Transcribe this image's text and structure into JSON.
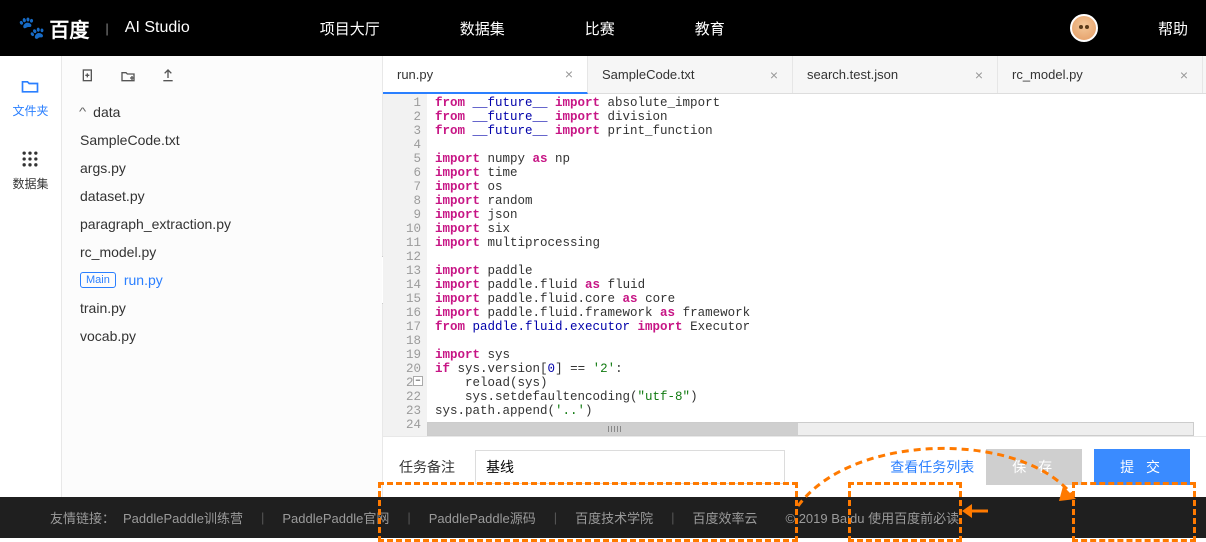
{
  "topnav": {
    "logo_text": "百度",
    "product": "AI Studio",
    "items": [
      "项目大厅",
      "数据集",
      "比赛",
      "教育"
    ],
    "help": "帮助"
  },
  "left_rail": {
    "files": "文件夹",
    "datasets": "数据集"
  },
  "file_tree": {
    "folder": "data",
    "items": [
      "SampleCode.txt",
      "args.py",
      "dataset.py",
      "paragraph_extraction.py",
      "rc_model.py",
      "run.py",
      "train.py",
      "vocab.py"
    ],
    "main_badge": "Main",
    "main_file": "run.py"
  },
  "tabs": [
    {
      "label": "run.py",
      "active": true
    },
    {
      "label": "SampleCode.txt",
      "active": false
    },
    {
      "label": "search.test.json",
      "active": false
    },
    {
      "label": "rc_model.py",
      "active": false
    }
  ],
  "code": {
    "lines": [
      [
        [
          "from",
          "kw-from"
        ],
        [
          " __future__ ",
          "kw-mod"
        ],
        [
          "import",
          "kw-import"
        ],
        [
          " absolute_import",
          ""
        ]
      ],
      [
        [
          "from",
          "kw-from"
        ],
        [
          " __future__ ",
          "kw-mod"
        ],
        [
          "import",
          "kw-import"
        ],
        [
          " division",
          ""
        ]
      ],
      [
        [
          "from",
          "kw-from"
        ],
        [
          " __future__ ",
          "kw-mod"
        ],
        [
          "import",
          "kw-import"
        ],
        [
          " print_function",
          ""
        ]
      ],
      [],
      [
        [
          "import",
          "kw-import"
        ],
        [
          " numpy ",
          ""
        ],
        [
          "as",
          "kw-as"
        ],
        [
          " np",
          ""
        ]
      ],
      [
        [
          "import",
          "kw-import"
        ],
        [
          " time",
          ""
        ]
      ],
      [
        [
          "import",
          "kw-import"
        ],
        [
          " os",
          ""
        ]
      ],
      [
        [
          "import",
          "kw-import"
        ],
        [
          " random",
          ""
        ]
      ],
      [
        [
          "import",
          "kw-import"
        ],
        [
          " json",
          ""
        ]
      ],
      [
        [
          "import",
          "kw-import"
        ],
        [
          " six",
          ""
        ]
      ],
      [
        [
          "import",
          "kw-import"
        ],
        [
          " multiprocessing",
          ""
        ]
      ],
      [],
      [
        [
          "import",
          "kw-import"
        ],
        [
          " paddle",
          ""
        ]
      ],
      [
        [
          "import",
          "kw-import"
        ],
        [
          " paddle.fluid ",
          ""
        ],
        [
          "as",
          "kw-as"
        ],
        [
          " fluid",
          ""
        ]
      ],
      [
        [
          "import",
          "kw-import"
        ],
        [
          " paddle.fluid.core ",
          ""
        ],
        [
          "as",
          "kw-as"
        ],
        [
          " core",
          ""
        ]
      ],
      [
        [
          "import",
          "kw-import"
        ],
        [
          " paddle.fluid.framework ",
          ""
        ],
        [
          "as",
          "kw-as"
        ],
        [
          " framework",
          ""
        ]
      ],
      [
        [
          "from",
          "kw-from"
        ],
        [
          " paddle.fluid.executor ",
          "kw-mod"
        ],
        [
          "import",
          "kw-import"
        ],
        [
          " Executor",
          ""
        ]
      ],
      [],
      [
        [
          "import",
          "kw-import"
        ],
        [
          " sys",
          ""
        ]
      ],
      [
        [
          "if",
          "kw-if"
        ],
        [
          " sys.version[",
          ""
        ],
        [
          "0",
          "kw-num"
        ],
        [
          "] == ",
          ""
        ],
        [
          "'2'",
          "kw-str"
        ],
        [
          ":",
          ""
        ]
      ],
      [
        [
          "    reload(sys)",
          ""
        ]
      ],
      [
        [
          "    sys.setdefaultencoding(",
          ""
        ],
        [
          "\"utf-8\"",
          "kw-str"
        ],
        [
          ")",
          ""
        ]
      ],
      [
        [
          "sys.path.append(",
          ""
        ],
        [
          "'..'",
          "kw-str"
        ],
        [
          ")",
          ""
        ]
      ],
      []
    ]
  },
  "bottom": {
    "task_label": "任务备注",
    "task_value": "基线",
    "view_tasks": "查看任务列表",
    "save": "保 存",
    "submit": "提 交"
  },
  "footer": {
    "prefix": "友情链接：",
    "links": [
      "PaddlePaddle训练营",
      "PaddlePaddle官网",
      "PaddlePaddle源码",
      "百度技术学院",
      "百度效率云"
    ],
    "copyright": "© 2019 Baidu 使用百度前必读"
  }
}
